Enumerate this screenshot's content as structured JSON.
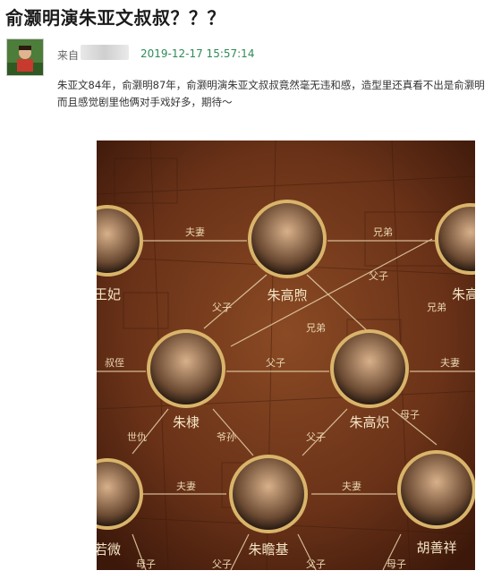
{
  "post": {
    "title": "俞灏明演朱亚文叔叔？？？",
    "from_label": "来自",
    "timestamp": "2019-12-17 15:57:14",
    "body_line1": "朱亚文84年，俞灏明87年，俞灏明演朱亚文叔叔竟然毫无违和感，造型里还真看不出是俞灏明",
    "body_line2": "而且感觉剧里他俩对手戏好多，期待～"
  },
  "poster": {
    "characters": [
      {
        "name": "王妃"
      },
      {
        "name": "朱高煦"
      },
      {
        "name": "朱高"
      },
      {
        "name": "朱棣"
      },
      {
        "name": "朱高炽"
      },
      {
        "name": "若微"
      },
      {
        "name": "朱瞻基"
      },
      {
        "name": "胡善祥"
      }
    ],
    "relations": [
      "夫妻",
      "兄弟",
      "父子",
      "父子",
      "兄弟",
      "兄弟",
      "叔侄",
      "父子",
      "夫妻",
      "世仇",
      "爷孙",
      "父子",
      "母子",
      "夫妻",
      "夫妻",
      "母子",
      "父子",
      "父子",
      "母子"
    ]
  }
}
